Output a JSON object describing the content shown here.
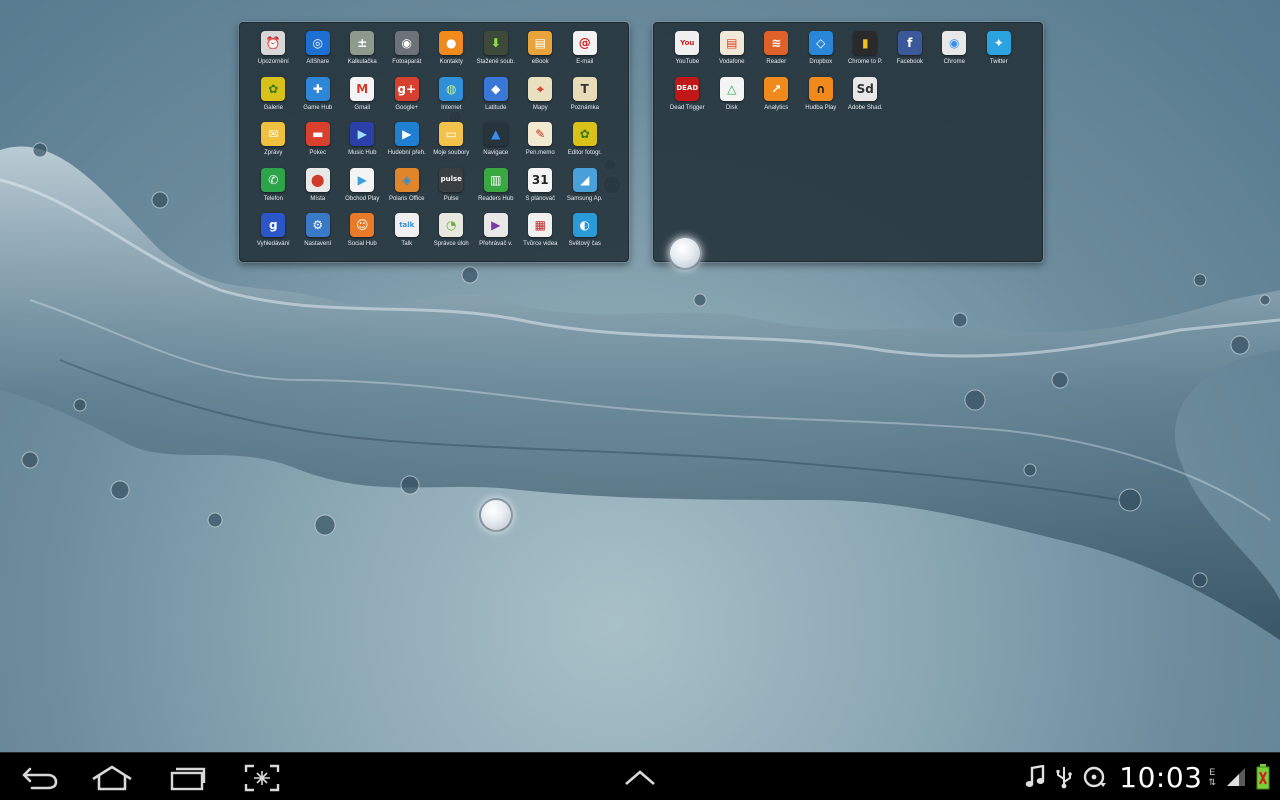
{
  "panels": [
    {
      "apps": [
        {
          "label": "Upozornění",
          "icon": "alarm-clock-icon",
          "glyph": "⏰",
          "color": "#d8d8d8",
          "fg": "#222"
        },
        {
          "label": "AllShare",
          "icon": "allshare-icon",
          "glyph": "◎",
          "color": "#1d6fd2",
          "fg": "#fff"
        },
        {
          "label": "Kalkulačka",
          "icon": "calculator-icon",
          "glyph": "±",
          "color": "#8e9a8c",
          "fg": "#fff"
        },
        {
          "label": "Fotoaparát",
          "icon": "camera-icon",
          "glyph": "◉",
          "color": "#6c7278",
          "fg": "#fff"
        },
        {
          "label": "Kontakty",
          "icon": "contacts-icon",
          "glyph": "●",
          "color": "#f08a1c",
          "fg": "#fff"
        },
        {
          "label": "Stažené soub.",
          "icon": "downloads-icon",
          "glyph": "⬇",
          "color": "#3d4a3a",
          "fg": "#8ee04a"
        },
        {
          "label": "eBook",
          "icon": "ebook-icon",
          "glyph": "▤",
          "color": "#e8a43a",
          "fg": "#fff"
        },
        {
          "label": "E-mail",
          "icon": "email-icon",
          "glyph": "@",
          "color": "#f2f2f2",
          "fg": "#d02020"
        },
        {
          "label": "Galerie",
          "icon": "gallery-icon",
          "glyph": "✿",
          "color": "#d8c21a",
          "fg": "#3a7a1a"
        },
        {
          "label": "Game Hub",
          "icon": "gamepad-icon",
          "glyph": "✚",
          "color": "#2d86d8",
          "fg": "#fff"
        },
        {
          "label": "Gmail",
          "icon": "gmail-icon",
          "glyph": "M",
          "color": "#f4f4f4",
          "fg": "#d23a2a"
        },
        {
          "label": "Google+",
          "icon": "google-plus-icon",
          "glyph": "g+",
          "color": "#d7402f",
          "fg": "#fff"
        },
        {
          "label": "Internet",
          "icon": "globe-icon",
          "glyph": "◍",
          "color": "#2f8fd8",
          "fg": "#bdf0a0"
        },
        {
          "label": "Latitude",
          "icon": "latitude-icon",
          "glyph": "◆",
          "color": "#3a78d8",
          "fg": "#fff"
        },
        {
          "label": "Mapy",
          "icon": "maps-icon",
          "glyph": "⌖",
          "color": "#e9e0c0",
          "fg": "#d03a2a"
        },
        {
          "label": "Poznámka",
          "icon": "memo-icon",
          "glyph": "T",
          "color": "#e8dcb8",
          "fg": "#333"
        },
        {
          "label": "Zprávy",
          "icon": "messages-icon",
          "glyph": "✉",
          "color": "#f0c040",
          "fg": "#fff"
        },
        {
          "label": "Pokec",
          "icon": "chat-icon",
          "glyph": "▬",
          "color": "#d9402e",
          "fg": "#fff"
        },
        {
          "label": "Music Hub",
          "icon": "music-hub-icon",
          "glyph": "▶",
          "color": "#2a3fa8",
          "fg": "#9fe0ff"
        },
        {
          "label": "Hudební přeh.",
          "icon": "music-player-icon",
          "glyph": "▶",
          "color": "#1f7fd0",
          "fg": "#fff"
        },
        {
          "label": "Moje soubory",
          "icon": "folder-icon",
          "glyph": "▭",
          "color": "#f2c24a",
          "fg": "#fff"
        },
        {
          "label": "Navigace",
          "icon": "navigation-icon",
          "glyph": "▲",
          "color": "#26343c",
          "fg": "#3a8ef0"
        },
        {
          "label": "Pen.memo",
          "icon": "pen-memo-icon",
          "glyph": "✎",
          "color": "#f2ead0",
          "fg": "#c03020"
        },
        {
          "label": "Editor fotogr.",
          "icon": "photo-editor-icon",
          "glyph": "✿",
          "color": "#d8c21a",
          "fg": "#3a7a1a"
        },
        {
          "label": "Telefon",
          "icon": "phone-icon",
          "glyph": "✆",
          "color": "#2ea44a",
          "fg": "#fff"
        },
        {
          "label": "Místa",
          "icon": "places-pin-icon",
          "glyph": "⬤",
          "color": "#e8e8e8",
          "fg": "#d03a2a"
        },
        {
          "label": "Obchod Play",
          "icon": "play-store-icon",
          "glyph": "▶",
          "color": "#f4f4f4",
          "fg": "#3aa0d8"
        },
        {
          "label": "Polaris Office",
          "icon": "polaris-office-icon",
          "glyph": "◈",
          "color": "#e0852a",
          "fg": "#2a8fd8"
        },
        {
          "label": "Pulse",
          "icon": "pulse-icon",
          "glyph": "pulse",
          "color": "#3a3f44",
          "fg": "#fff"
        },
        {
          "label": "Readers Hub",
          "icon": "readers-hub-icon",
          "glyph": "▥",
          "color": "#3aa840",
          "fg": "#fff"
        },
        {
          "label": "S plánovač",
          "icon": "calendar-icon",
          "glyph": "31",
          "color": "#f4f4f4",
          "fg": "#222"
        },
        {
          "label": "Samsung Ap.",
          "icon": "samsung-apps-icon",
          "glyph": "◢",
          "color": "#4aa0d8",
          "fg": "#fff"
        },
        {
          "label": "Vyhledávání",
          "icon": "google-search-icon",
          "glyph": "g",
          "color": "#2a56c8",
          "fg": "#fff"
        },
        {
          "label": "Nastavení",
          "icon": "settings-gear-icon",
          "glyph": "⚙",
          "color": "#3a78c8",
          "fg": "#fff"
        },
        {
          "label": "Social Hub",
          "icon": "social-hub-icon",
          "glyph": "☺",
          "color": "#e87a2a",
          "fg": "#fff"
        },
        {
          "label": "Talk",
          "icon": "talk-icon",
          "glyph": "talk",
          "color": "#f0f0f0",
          "fg": "#3a8fd8"
        },
        {
          "label": "Správce úloh",
          "icon": "task-manager-icon",
          "glyph": "◔",
          "color": "#e8e8e0",
          "fg": "#6ab03a"
        },
        {
          "label": "Přehrávač v.",
          "icon": "video-player-icon",
          "glyph": "▶",
          "color": "#e8e8e8",
          "fg": "#7a3aa8"
        },
        {
          "label": "Tvůrce videa",
          "icon": "video-maker-icon",
          "glyph": "▦",
          "color": "#f0f0f0",
          "fg": "#c02a2a"
        },
        {
          "label": "Světový čas",
          "icon": "world-clock-icon",
          "glyph": "◐",
          "color": "#2a9ad8",
          "fg": "#fff"
        }
      ]
    },
    {
      "apps": [
        {
          "label": "YouTube",
          "icon": "youtube-icon",
          "glyph": "You",
          "color": "#f0f0f0",
          "fg": "#d02020"
        },
        {
          "label": "Vodafone",
          "icon": "vodafone-icon",
          "glyph": "▤",
          "color": "#f2e8d8",
          "fg": "#e04020"
        },
        {
          "label": "Reader",
          "icon": "rss-reader-icon",
          "glyph": "≋",
          "color": "#e0602a",
          "fg": "#fff"
        },
        {
          "label": "Dropbox",
          "icon": "dropbox-icon",
          "glyph": "◇",
          "color": "#2a86d8",
          "fg": "#fff"
        },
        {
          "label": "Chrome to P.",
          "icon": "chrome-to-phone-icon",
          "glyph": "▮",
          "color": "#2a2a2a",
          "fg": "#f0c020"
        },
        {
          "label": "Facebook",
          "icon": "facebook-icon",
          "glyph": "f",
          "color": "#3b5998",
          "fg": "#fff"
        },
        {
          "label": "Chrome",
          "icon": "chrome-icon",
          "glyph": "◉",
          "color": "#e8e8e8",
          "fg": "#3a8ef0"
        },
        {
          "label": "Twitter",
          "icon": "twitter-bird-icon",
          "glyph": "✦",
          "color": "#2aa3e0",
          "fg": "#fff"
        },
        {
          "label": "Dead Trigger",
          "icon": "dead-trigger-icon",
          "glyph": "DEAD",
          "color": "#c01818",
          "fg": "#fff"
        },
        {
          "label": "Disk",
          "icon": "google-drive-icon",
          "glyph": "△",
          "color": "#f4f4f4",
          "fg": "#2aa84a"
        },
        {
          "label": "Analytics",
          "icon": "analytics-icon",
          "glyph": "↗",
          "color": "#f08a1c",
          "fg": "#fff"
        },
        {
          "label": "Hudba Play",
          "icon": "play-music-icon",
          "glyph": "∩",
          "color": "#f08a1c",
          "fg": "#222"
        },
        {
          "label": "Adobe Shad.",
          "icon": "adobe-shadow-icon",
          "glyph": "Sd",
          "color": "#e8e8e8",
          "fg": "#333"
        }
      ]
    }
  ],
  "navbar": {
    "back": "back-arrow-icon",
    "home": "home-icon",
    "recent": "recent-apps-icon",
    "screenshot": "screenshot-capture-icon",
    "up": "chevron-up-icon"
  },
  "status": {
    "time": "10:03",
    "network_type": "E",
    "icons": [
      "music-note-icon",
      "usb-icon",
      "sync-disc-icon",
      "signal-strength-icon",
      "battery-charging-icon"
    ]
  },
  "colors": {
    "panel_bg": "#26343c",
    "navbar_bg": "#000000",
    "label_text": "#e4eaee"
  }
}
